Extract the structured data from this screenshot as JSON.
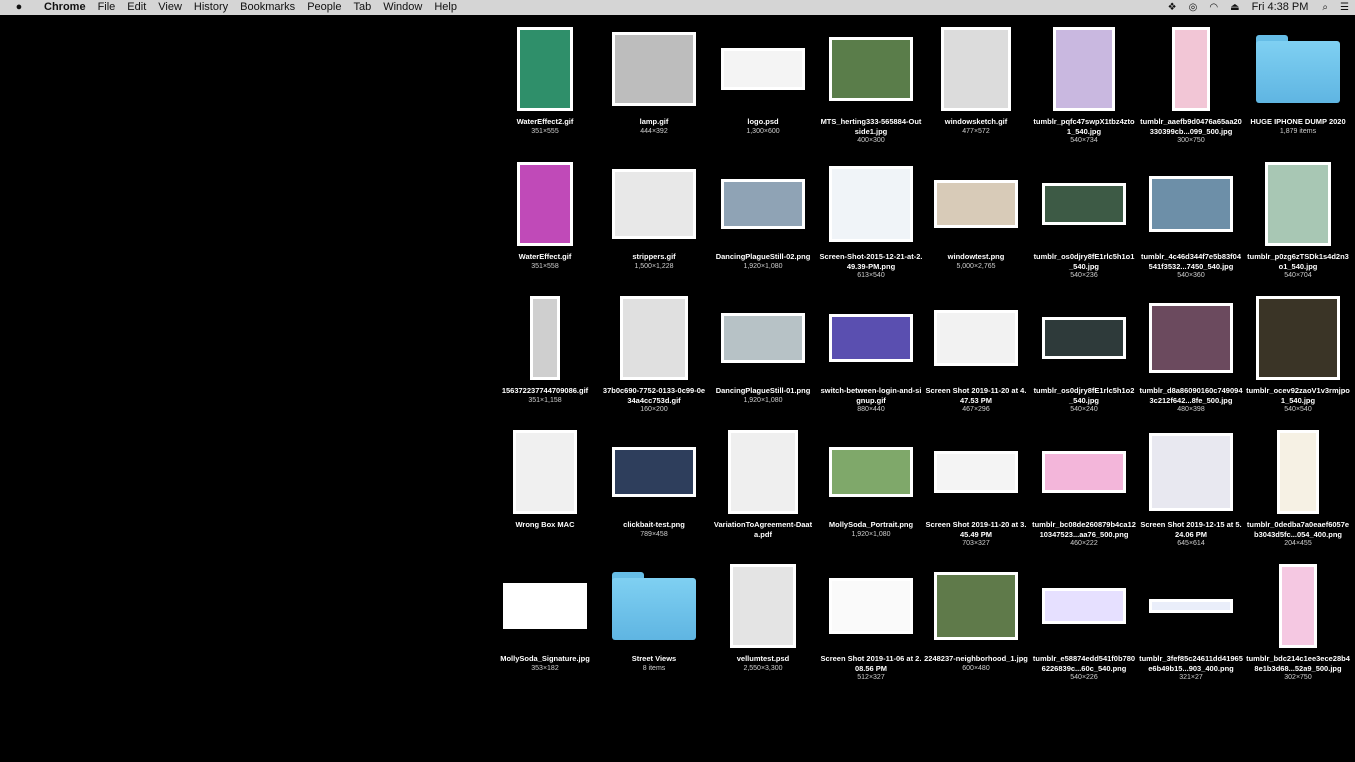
{
  "menubar": {
    "apple_icon": "",
    "app_name": "Chrome",
    "items": [
      "File",
      "Edit",
      "View",
      "History",
      "Bookmarks",
      "People",
      "Tab",
      "Window",
      "Help"
    ],
    "clock": "Fri 4:38 PM",
    "status_icons": [
      "dropbox-icon",
      "creative-cloud-icon",
      "wifi-icon",
      "eject-icon"
    ]
  },
  "desktop": {
    "icons": [
      {
        "name": "WaterEffect2.gif",
        "info": "351×555",
        "kind": "image",
        "color": "#2f8f6a"
      },
      {
        "name": "lamp.gif",
        "info": "444×392",
        "kind": "image",
        "color": "#bdbdbd"
      },
      {
        "name": "logo.psd",
        "info": "1,300×600",
        "kind": "image",
        "color": "#f4f4f4"
      },
      {
        "name": "MTS_herting333-565884-Outside1.jpg",
        "info": "400×300",
        "kind": "image",
        "color": "#5a7d4a"
      },
      {
        "name": "windowsketch.gif",
        "info": "477×572",
        "kind": "image",
        "color": "#dcdcdc"
      },
      {
        "name": "tumblr_pqfc47swpX1tbz4zto1_540.jpg",
        "info": "540×734",
        "kind": "image",
        "color": "#c9b8e0"
      },
      {
        "name": "tumblr_aaefb9d0476a65aa20330399cb...099_500.jpg",
        "info": "300×750",
        "kind": "image",
        "color": "#f2c6d6"
      },
      {
        "name": "HUGE IPHONE DUMP 2020",
        "info": "1,879 items",
        "kind": "folder"
      },
      {
        "name": "WaterEffect.gif",
        "info": "351×558",
        "kind": "image",
        "color": "#c04ab8"
      },
      {
        "name": "strippers.gif",
        "info": "1,500×1,228",
        "kind": "image",
        "color": "#e8e8e8"
      },
      {
        "name": "DancingPlagueStill-02.png",
        "info": "1,920×1,080",
        "kind": "image",
        "color": "#8fa3b5"
      },
      {
        "name": "Screen-Shot-2015-12-21-at-2.49.39-PM.png",
        "info": "613×540",
        "kind": "image",
        "color": "#f0f4f8"
      },
      {
        "name": "windowtest.png",
        "info": "5,000×2,765",
        "kind": "image",
        "color": "#d8cbb8"
      },
      {
        "name": "tumblr_os0djry8fE1rlc5h1o1_540.jpg",
        "info": "540×236",
        "kind": "image",
        "color": "#3d5a45"
      },
      {
        "name": "tumblr_4c46d344f7e5b83f04541f3532...7450_540.jpg",
        "info": "540×360",
        "kind": "image",
        "color": "#6d8fa8"
      },
      {
        "name": "tumblr_p0zg6zTSDk1s4d2n3o1_540.jpg",
        "info": "540×704",
        "kind": "image",
        "color": "#a8c7b4"
      },
      {
        "name": "156372237744709086.gif",
        "info": "351×1,158",
        "kind": "image",
        "color": "#cfcfcf"
      },
      {
        "name": "37b0c690-7752-0133-0c99-0e34a4cc753d.gif",
        "info": "160×200",
        "kind": "image",
        "color": "#e0e0e0"
      },
      {
        "name": "DancingPlagueStill-01.png",
        "info": "1,920×1,080",
        "kind": "image",
        "color": "#b7c2c6"
      },
      {
        "name": "switch-between-login-and-signup.gif",
        "info": "880×440",
        "kind": "image",
        "color": "#5a4fb0"
      },
      {
        "name": "Screen Shot 2019-11-20 at 4.47.53 PM",
        "info": "467×296",
        "kind": "image",
        "color": "#f2f2f2"
      },
      {
        "name": "tumblr_os0djry8fE1rlc5h1o2_540.jpg",
        "info": "540×240",
        "kind": "image",
        "color": "#2e3a3a"
      },
      {
        "name": "tumblr_d8a86090160c7490943c212f642...8fe_500.jpg",
        "info": "480×398",
        "kind": "image",
        "color": "#6b4a5e"
      },
      {
        "name": "tumblr_ocev92zaoV1v3rmjpo1_540.jpg",
        "info": "540×540",
        "kind": "image",
        "color": "#3a3426"
      },
      {
        "name": "Wrong Box MAC",
        "info": "",
        "kind": "image",
        "color": "#f0f0f0"
      },
      {
        "name": "clickbait-test.png",
        "info": "789×458",
        "kind": "image",
        "color": "#2e3e5c"
      },
      {
        "name": "VariationToAgreement-Daata.pdf",
        "info": "",
        "kind": "image",
        "color": "#efefef"
      },
      {
        "name": "MollySoda_Portrait.png",
        "info": "1,920×1,080",
        "kind": "image",
        "color": "#7fa86a"
      },
      {
        "name": "Screen Shot 2019-11-20 at 3.45.49 PM",
        "info": "703×327",
        "kind": "image",
        "color": "#f4f4f4"
      },
      {
        "name": "tumblr_bc08de260879b4ca1210347523...aa76_500.png",
        "info": "460×222",
        "kind": "image",
        "color": "#f3b6da"
      },
      {
        "name": "Screen Shot 2019-12-15 at 5.24.06 PM",
        "info": "645×614",
        "kind": "image",
        "color": "#e8e8f0"
      },
      {
        "name": "tumblr_0dedba7a0eaef6057eb3043d5fc...054_400.png",
        "info": "204×455",
        "kind": "image",
        "color": "#f6f1e4"
      },
      {
        "name": "MollySoda_Signature.jpg",
        "info": "353×182",
        "kind": "image",
        "color": "#ffffff"
      },
      {
        "name": "Street Views",
        "info": "8 items",
        "kind": "folder"
      },
      {
        "name": "vellumtest.psd",
        "info": "2,550×3,300",
        "kind": "image",
        "color": "#e4e4e4"
      },
      {
        "name": "Screen Shot 2019-11-06 at 2.08.56 PM",
        "info": "512×327",
        "kind": "image",
        "color": "#fafafa"
      },
      {
        "name": "2248237-neighborhood_1.jpg",
        "info": "600×480",
        "kind": "image",
        "color": "#5f7a4a"
      },
      {
        "name": "tumblr_e58874edd541f0b7806226839c...60c_540.png",
        "info": "540×226",
        "kind": "image",
        "color": "#e6e0ff"
      },
      {
        "name": "tumblr_3fef85c24611dd41965e6b49b15...903_400.png",
        "info": "321×27",
        "kind": "image",
        "color": "#eaeefa"
      },
      {
        "name": "tumblr_bdc214c1ee3ece28b48e1b3d68...52a9_500.jpg",
        "info": "302×750",
        "kind": "image",
        "color": "#f5c8e2"
      }
    ]
  }
}
